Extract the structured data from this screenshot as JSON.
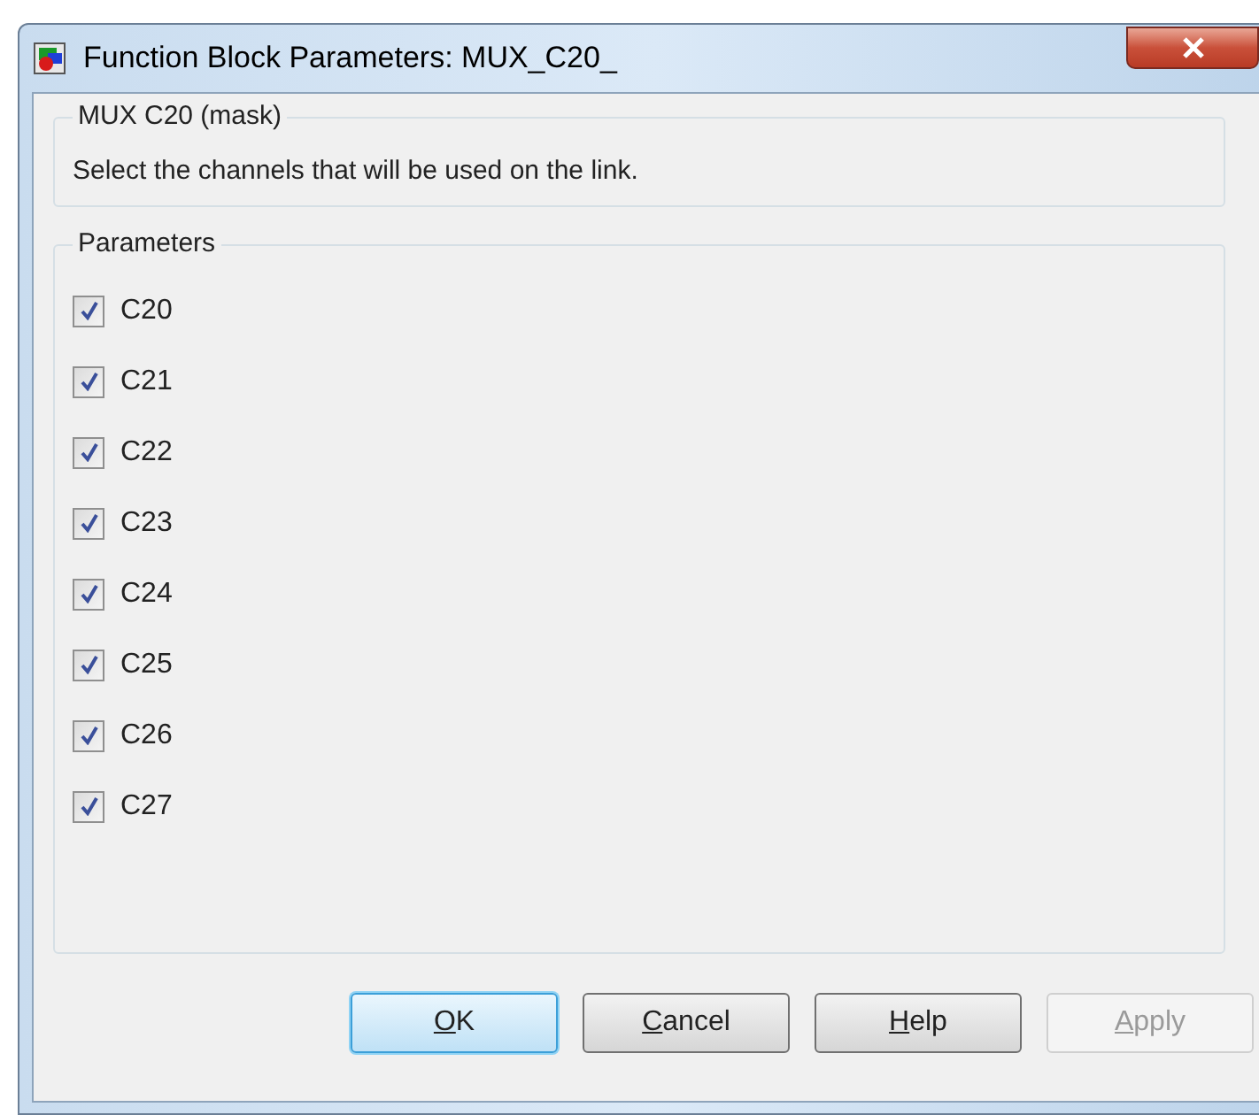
{
  "window": {
    "title": "Function Block Parameters: MUX_C20_"
  },
  "mask_group": {
    "title": "MUX C20 (mask)",
    "description": "Select the channels that will be used on the link."
  },
  "parameters": {
    "title": "Parameters",
    "items": [
      {
        "label": "C20",
        "checked": true
      },
      {
        "label": "C21",
        "checked": true
      },
      {
        "label": "C22",
        "checked": true
      },
      {
        "label": "C23",
        "checked": true
      },
      {
        "label": "C24",
        "checked": true
      },
      {
        "label": "C25",
        "checked": true
      },
      {
        "label": "C26",
        "checked": true
      },
      {
        "label": "C27",
        "checked": true
      }
    ]
  },
  "buttons": [
    {
      "mnemonic": "O",
      "rest": "K",
      "default": true,
      "disabled": false
    },
    {
      "mnemonic": "C",
      "rest": "ancel",
      "default": false,
      "disabled": false
    },
    {
      "mnemonic": "H",
      "rest": "elp",
      "default": false,
      "disabled": false
    },
    {
      "mnemonic": "A",
      "rest": "pply",
      "default": false,
      "disabled": true
    }
  ]
}
